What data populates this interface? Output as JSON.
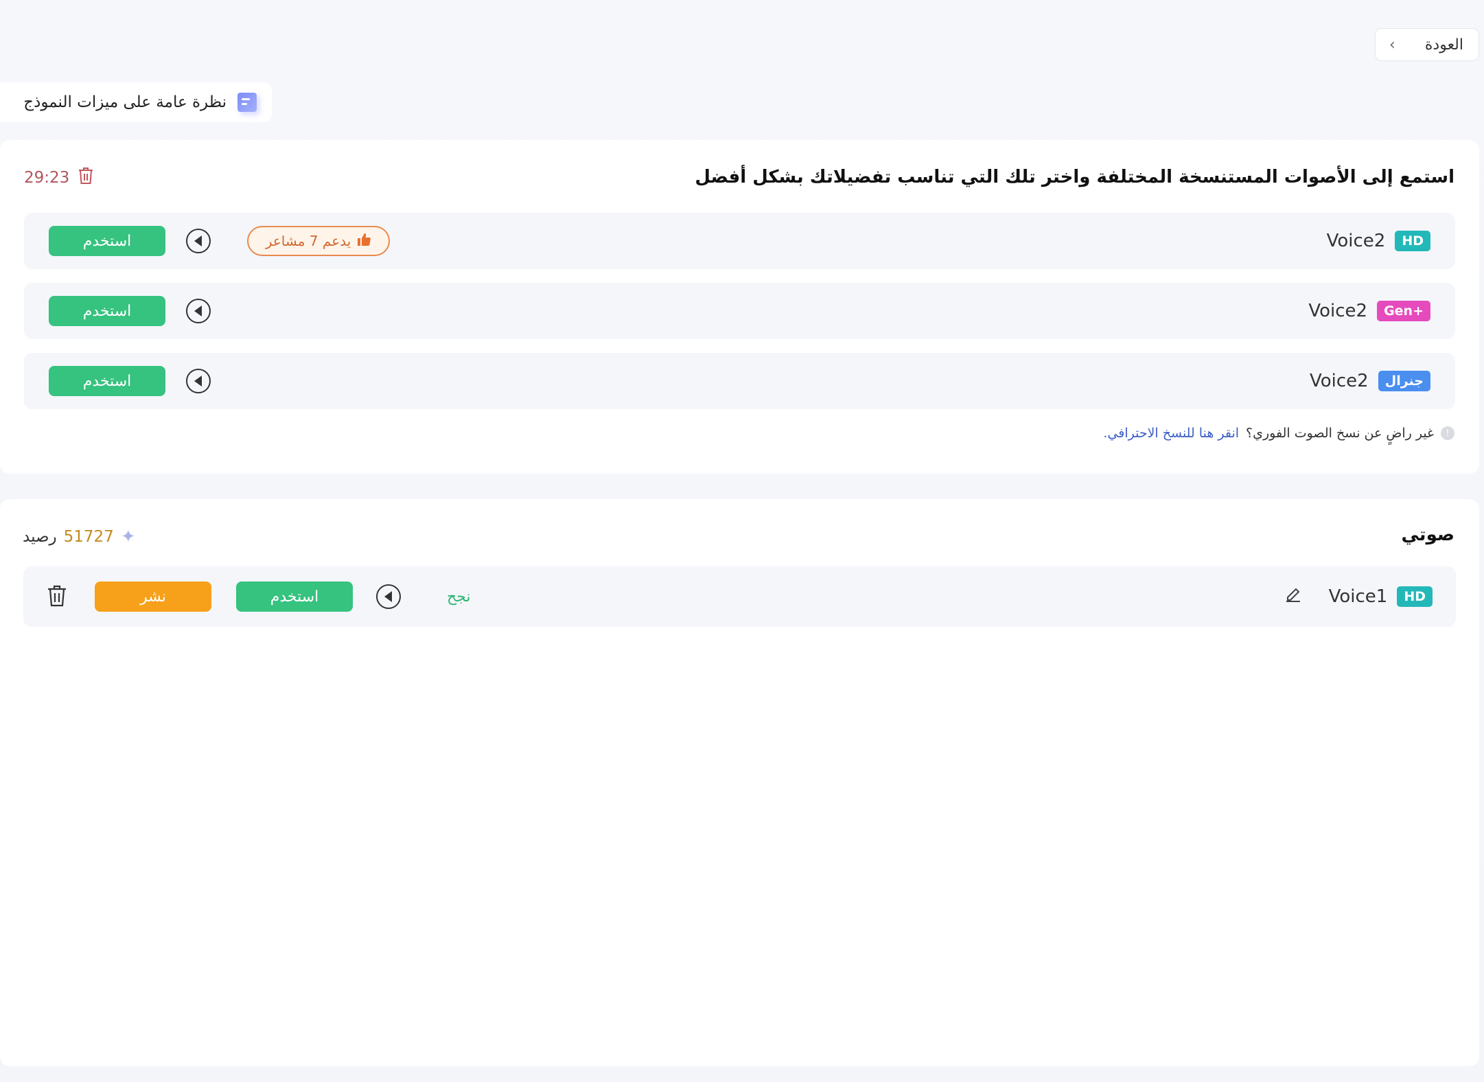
{
  "header": {
    "back_label": "العودة",
    "overview_label": "نظرة عامة على ميزات النموذج"
  },
  "cloned_section": {
    "title": "استمع إلى الأصوات المستنسخة المختلفة واختر تلك التي تناسب تفضيلاتك بشكل أفضل",
    "timer": "29:23",
    "rows": [
      {
        "voice_name": "Voice2",
        "tag": "HD",
        "use_label": "استخدم",
        "badge": "يدعم 7 مشاعر"
      },
      {
        "voice_name": "Voice2",
        "tag": "Gen+",
        "use_label": "استخدم"
      },
      {
        "voice_name": "Voice2",
        "tag": "جنرال",
        "use_label": "استخدم"
      }
    ],
    "note_text": "غير راضٍ عن نسخ الصوت الفوري؟",
    "note_link": "انقر هنا للنسخ الاحترافي."
  },
  "my_voice_section": {
    "title": "صوتي",
    "credit_value": "51727",
    "credit_label": "رصيد",
    "row": {
      "voice_name": "Voice1",
      "tag": "HD",
      "status": "نجح",
      "use_label": "استخدم",
      "publish_label": "نشر"
    }
  },
  "colors": {
    "use_button": "#36c27f",
    "publish_button": "#f7a01a",
    "tag_hd": "#23b8b8",
    "tag_gen": "#e54bbd",
    "tag_general": "#4a8ef0"
  }
}
